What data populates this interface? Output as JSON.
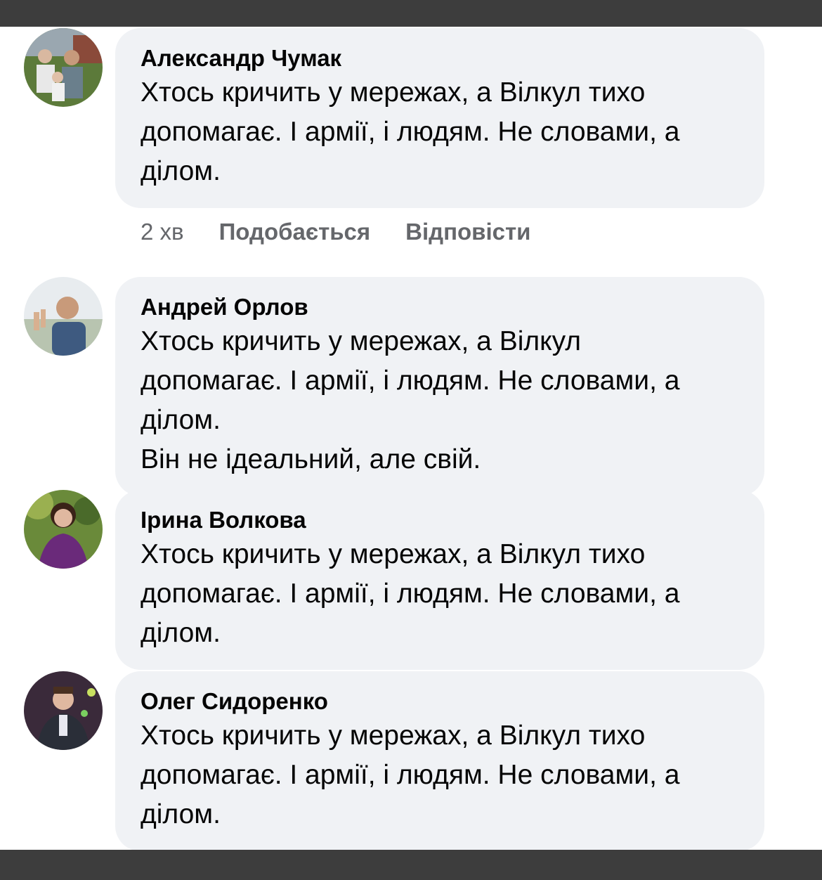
{
  "comments": [
    {
      "author": "Александр Чумак",
      "lines": [
        "Хтось кричить у мережах, а Вілкул тихо",
        "допомагає. І армії, і людям. Не словами, а",
        "ділом."
      ],
      "time": "2 хв",
      "like": "Подобається",
      "reply": "Відповісти"
    },
    {
      "author": "Андрей Орлов",
      "lines": [
        "Хтось кричить у мережах, а Вілкул",
        "допомагає. І армії, і людям. Не словами, а",
        "ділом.",
        "Він не ідеальний, але свій."
      ]
    },
    {
      "author": "Ірина Волкова",
      "lines": [
        "Хтось кричить у мережах, а Вілкул тихо",
        "допомагає. І армії, і людям. Не словами, а",
        "ділом."
      ]
    },
    {
      "author": "Олег Сидоренко",
      "lines": [
        "Хтось кричить у мережах, а Вілкул тихо",
        "допомагає. І армії, і людям. Не словами, а",
        "ділом."
      ]
    }
  ]
}
